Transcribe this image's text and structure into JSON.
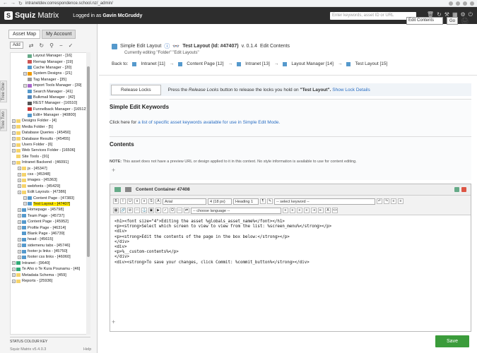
{
  "browser": {
    "url": "intranetdev.correspondence.school.nz/_admin/"
  },
  "header": {
    "brand": "Squiz",
    "brand_suffix": "Matrix",
    "login_prefix": "Logged in as",
    "user": "Gavin McGruddy",
    "search_placeholder": "Enter keywords, asset ID or URL"
  },
  "left": {
    "tabs": [
      "Asset Map",
      "My Account"
    ],
    "vtabs": [
      "Tree One",
      "Tree Two"
    ],
    "add_label": "Add",
    "tree": [
      {
        "label": "Layout Manager - [16]",
        "indent": 2,
        "icon": "#6a8",
        "tog": false
      },
      {
        "label": "Remap Manager - [19]",
        "indent": 2,
        "icon": "#c55",
        "tog": false
      },
      {
        "label": "Cache Manager - [20]",
        "indent": 2,
        "icon": "#59c",
        "tog": false
      },
      {
        "label": "System Designs - [21]",
        "indent": 2,
        "icon": "#e90",
        "tog": true
      },
      {
        "label": "Tag Manager - [35]",
        "indent": 2,
        "icon": "#999",
        "tog": false
      },
      {
        "label": "Import Tools Manager - [39]",
        "indent": 2,
        "icon": "#a6c",
        "tog": true
      },
      {
        "label": "Search Manager - [41]",
        "indent": 2,
        "icon": "#59c",
        "tog": false
      },
      {
        "label": "Bulkmail Manager - [42]",
        "indent": 2,
        "icon": "#58b",
        "tog": false
      },
      {
        "label": "REST Manager - [16510]",
        "indent": 2,
        "icon": "#555",
        "tog": false
      },
      {
        "label": "Funnelback Manager - [16512]",
        "indent": 2,
        "icon": "#c33",
        "tog": false
      },
      {
        "label": "Edit+ Manager - [40800]",
        "indent": 2,
        "icon": "#59c",
        "tog": false
      },
      {
        "label": "Designs Folder - [4]",
        "indent": 0,
        "icon": "#f5d36b",
        "tog": true
      },
      {
        "label": "Media Folder - [5]",
        "indent": 0,
        "icon": "#f5d36b",
        "tog": true
      },
      {
        "label": "Database Queries - [45450]",
        "indent": 0,
        "icon": "#f5d36b",
        "tog": true
      },
      {
        "label": "Database Results - [45455]",
        "indent": 0,
        "icon": "#f5d36b",
        "tog": true
      },
      {
        "label": "Users Folder - [6]",
        "indent": 0,
        "icon": "#f5d36b",
        "tog": true
      },
      {
        "label": "Web Services Folder - [16506]",
        "indent": 0,
        "icon": "#f5d36b",
        "tog": true
      },
      {
        "label": "Site Tools - [91]",
        "indent": 0,
        "icon": "#f5d36b",
        "tog": false
      },
      {
        "label": "Intranet Backend - [46091]",
        "indent": 0,
        "icon": "#f5d36b",
        "tog": true
      },
      {
        "label": "js - [45347]",
        "indent": 1,
        "icon": "#f5d36b",
        "tog": true
      },
      {
        "label": "css - [45348]",
        "indent": 1,
        "icon": "#f5d36b",
        "tog": true
      },
      {
        "label": "images - [45363]",
        "indent": 1,
        "icon": "#f5d36b",
        "tog": true
      },
      {
        "label": "webfonts - [45429]",
        "indent": 1,
        "icon": "#f5d36b",
        "tog": true
      },
      {
        "label": "Edit Layouts - [47386]",
        "indent": 1,
        "icon": "#f5d36b",
        "tog": true
      },
      {
        "label": "Content Page - [47383]",
        "indent": 2,
        "icon": "#59c",
        "tog": true
      },
      {
        "label": "Test Layout - [47407]",
        "indent": 2,
        "icon": "#59c",
        "tog": true,
        "selected": true
      },
      {
        "label": "Homepage - [45798]",
        "indent": 1,
        "icon": "#59c",
        "tog": true
      },
      {
        "label": "Team Page - [45737]",
        "indent": 1,
        "icon": "#59c",
        "tog": true
      },
      {
        "label": "Content Page - [45952]",
        "indent": 1,
        "icon": "#59c",
        "tog": true
      },
      {
        "label": "Profile Page - [46314]",
        "indent": 1,
        "icon": "#59c",
        "tog": true
      },
      {
        "label": "Blank Page - [46739]",
        "indent": 1,
        "icon": "#59c",
        "tog": false
      },
      {
        "label": "head - [45615]",
        "indent": 1,
        "icon": "#59c",
        "tog": true
      },
      {
        "label": "sidemenu tabs - [45746]",
        "indent": 1,
        "icon": "#59c",
        "tog": true
      },
      {
        "label": "footer js links - [45750]",
        "indent": 1,
        "icon": "#59c",
        "tog": true
      },
      {
        "label": "footer css links - [46060]",
        "indent": 1,
        "icon": "#59c",
        "tog": true
      },
      {
        "label": "Intranet - [9640]",
        "indent": 0,
        "icon": "#3a7",
        "tog": true
      },
      {
        "label": "Te Aho o Te Kura Pounamu - [46]",
        "indent": 0,
        "icon": "#3a7",
        "tog": true
      },
      {
        "label": "Metadata Schema - [459]",
        "indent": 0,
        "icon": "#f5d36b",
        "tog": true
      },
      {
        "label": "Reports - [25936]",
        "indent": 0,
        "icon": "#f5d36b",
        "tog": true
      }
    ],
    "status_key": "STATUS COLOUR KEY",
    "version": "Squiz Matrix v5.4.0.3",
    "help": "Help"
  },
  "main": {
    "screen_title": "Simple Edit Layout",
    "asset_title": "Test Layout (Id: #47407)",
    "version": "v. 0.1.4",
    "edit_contents": "Edit Contents",
    "currently_editing": "Currently editing \"Folder\" \"Edit Layouts\"",
    "screen_select": "Edit Contents",
    "go": "Go",
    "breadcrumb": [
      "Back to:",
      "Intranet [11]",
      "Content Page [12]",
      "Intranet [13]",
      "Layout Manager [14]",
      "Test Layout [15]"
    ],
    "release_btn": "Release Locks",
    "release_pre": "Press the",
    "release_italic": "Release Locks",
    "release_mid": "button to release the locks you hold on",
    "release_asset": "\"Test Layout\".",
    "release_link": "Show Lock Details",
    "kw_title": "Simple Edit Keywords",
    "kw_pre": "Click here for",
    "kw_link": "a list of specific asset keywords available for use in Simple Edit Mode.",
    "contents_title": "Contents",
    "note_label": "NOTE:",
    "note_text": "This asset does not have a preview URL or design applied to it in this context. No style information is available to use for content editing.",
    "cc_title": "Content Container 47408",
    "font": "Arial",
    "size": "4 (18 px)",
    "heading": "Heading 1",
    "keyword": "-- select keyword --",
    "language": "-- choose language --",
    "code": "<h1><font size=\"4\">Editing the asset %globals_asset_name%</font></h1>\n<p><strong>Select which screen to view to view from the list: %screen_menu%</strong></p>\n<div>\n<p><strong>Edit the contents of the page in the box below:</strong></p>\n</div>\n<div>\n<p>%__custom-contents%</p>\n</div>\n<div><strong>To save your changes, click Commit: %commit_button%</strong></div>",
    "save": "Save"
  }
}
